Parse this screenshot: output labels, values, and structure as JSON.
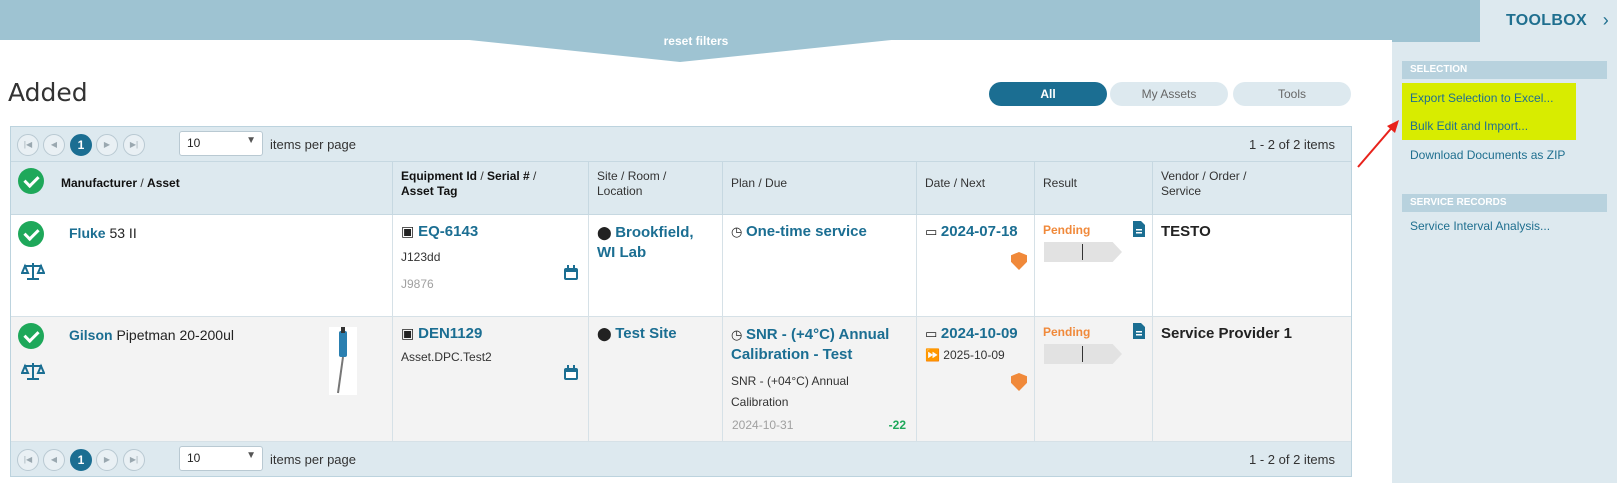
{
  "filters": {
    "reset_label": "reset filters"
  },
  "page": {
    "title": "Added"
  },
  "segments": {
    "all": "All",
    "my_assets": "My Assets",
    "tools": "Tools"
  },
  "pager": {
    "current_page": "1",
    "page_size": "10",
    "items_per_page": "items per page",
    "count": "1 - 2 of 2 items"
  },
  "columns": {
    "manufacturer": "Manufacturer",
    "asset": "Asset",
    "equipment_id": "Equipment Id",
    "serial": "Serial #",
    "asset_tag": "Asset Tag",
    "site": "Site",
    "room": "Room",
    "location": "Location",
    "plan": "Plan",
    "due": "Due",
    "date": "Date",
    "next": "Next",
    "result": "Result",
    "vendor": "Vendor",
    "order": "Order",
    "service": "Service"
  },
  "rows": [
    {
      "manufacturer": "Fluke",
      "model": "53 II",
      "equipment_id": "EQ-6143",
      "serial": "J123dd",
      "asset_tag": "J9876",
      "site": "Brookfield, WI Lab",
      "plan": "One-time service",
      "date": "2024-07-18",
      "result": "Pending",
      "vendor": "TESTO"
    },
    {
      "manufacturer": "Gilson",
      "model": "Pipetman 20-200ul",
      "equipment_id": "DEN1129",
      "serial": "Asset.DPC.Test2",
      "site": "Test Site",
      "plan": "SNR - (+4°C) Annual Calibration - Test",
      "plan_detail": "SNR - (+04°C) Annual Calibration",
      "plan_due": "2024-10-31",
      "plan_days": "-22",
      "date": "2024-10-09",
      "next": "2025-10-09",
      "result": "Pending",
      "vendor": "Service Provider 1"
    }
  ],
  "toolbox": {
    "title": "TOOLBOX",
    "selection_header": "SELECTION",
    "export_excel": "Export Selection to Excel...",
    "bulk_edit": "Bulk Edit and Import...",
    "download_zip": "Download Documents as ZIP",
    "service_records_header": "SERVICE RECORDS",
    "service_interval": "Service Interval Analysis..."
  },
  "colors": {
    "accent": "#1b6e92",
    "highlight": "#d8ec00",
    "pending": "#f0893a",
    "success": "#1ea85a",
    "band": "#9ec3d2"
  }
}
